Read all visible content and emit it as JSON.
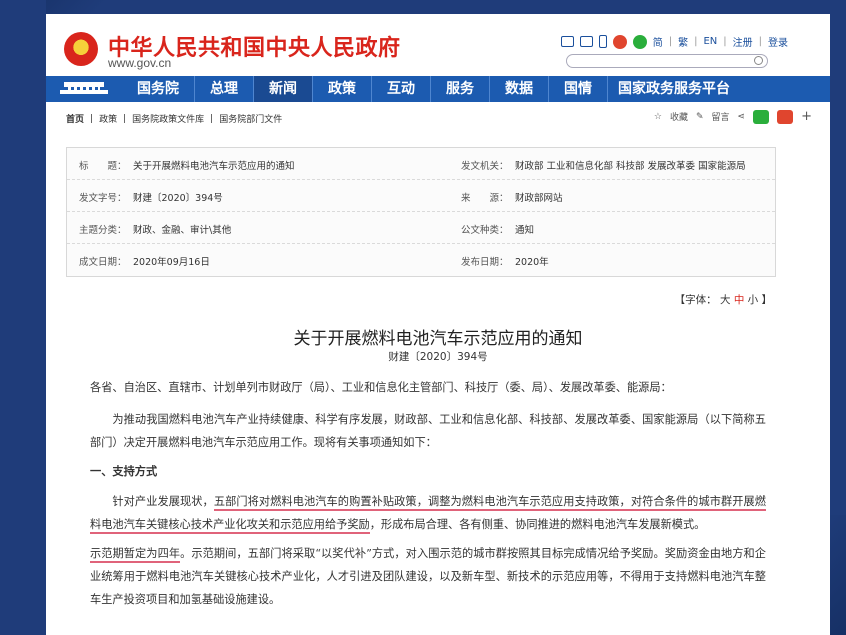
{
  "site": {
    "title": "中华人民共和国中央人民政府",
    "domain": "www.gov.cn"
  },
  "top_links": {
    "simplified": "简",
    "traditional": "繁",
    "english": "EN",
    "register": "注册",
    "login": "登录"
  },
  "nav": {
    "items": [
      "国务院",
      "总理",
      "新闻",
      "政策",
      "互动",
      "服务",
      "数据",
      "国情",
      "国家政务服务平台"
    ],
    "active_index": 2
  },
  "breadcrumb": [
    "首页",
    "政策",
    "国务院政策文件库",
    "国务院部门文件"
  ],
  "actions": {
    "favorite": "收藏",
    "comment": "留言"
  },
  "info": {
    "title_label": "标　　题：",
    "title_value": "关于开展燃料电池汽车示范应用的通知",
    "issuer_label": "发文机关：",
    "issuer_value": "财政部 工业和信息化部 科技部 发展改革委 国家能源局",
    "docno_label": "发文字号：",
    "docno_value": "财建〔2020〕394号",
    "source_label": "来　　源：",
    "source_value": "财政部网站",
    "topic_label": "主题分类：",
    "topic_value": "财政、金融、审计\\其他",
    "genre_label": "公文种类：",
    "genre_value": "通知",
    "created_label": "成文日期：",
    "created_value": "2020年09月16日",
    "published_label": "发布日期：",
    "published_value": "2020年"
  },
  "font_size": {
    "prefix": "【字体：",
    "large": "大",
    "medium": "中",
    "small": "小",
    "suffix": "】"
  },
  "document": {
    "title": "关于开展燃料电池汽车示范应用的通知",
    "number": "财建〔2020〕394号",
    "p1": "各省、自治区、直辖市、计划单列市财政厅（局）、工业和信息化主管部门、科技厅（委、局）、发展改革委、能源局：",
    "p2": "为推动我国燃料电池汽车产业持续健康、科学有序发展，财政部、工业和信息化部、科技部、发展改革委、国家能源局（以下简称五部门）决定开展燃料电池汽车示范应用工作。现将有关事项通知如下：",
    "p3": "一、支持方式",
    "p4_a": "针对产业发展现状，",
    "p4_u1": "五部门将对燃料电池汽车的购置补贴政策，调整为燃料电池汽车示范应用支持政策，对符合条件的城市群开展燃料电池汽车关键核心技术产业化攻关和示范应用给予奖励",
    "p4_b": "，形成布局合理、各有侧重、协同推进的燃料电池汽车发展新模式。",
    "p5_u": "示范期暂定为四年",
    "p5_b": "。示范期间，五部门将采取“以奖代补”方式，对入围示范的城市群按照其目标完成情况给予奖励。奖励资金由地方和企业统筹用于燃料电池汽车关键核心技术产业化，人才引进及团队建设，以及新车型、新技术的示范应用等，不得用于支持燃料电池汽车整车生产投资项目和加氢基础设施建设。"
  }
}
